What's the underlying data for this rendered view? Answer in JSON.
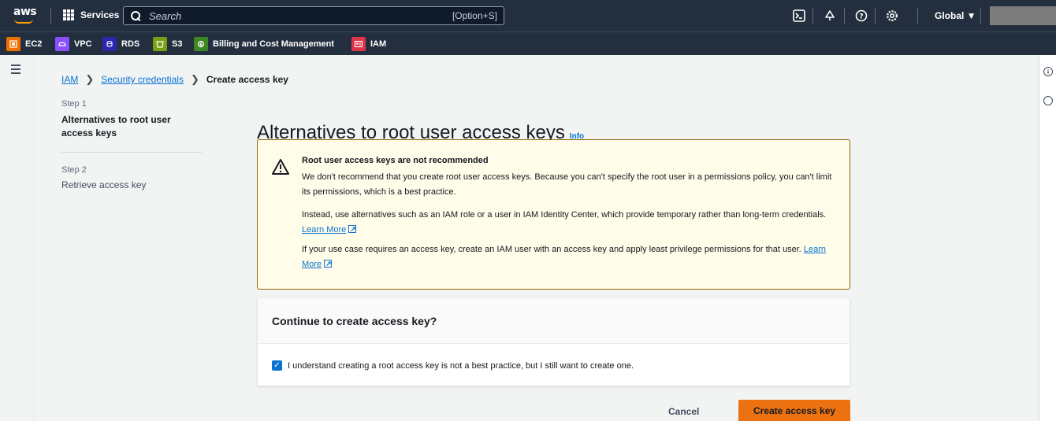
{
  "topbar": {
    "logo_text": "aws",
    "services_label": "Services",
    "search_placeholder": "Search",
    "search_shortcut": "[Option+S]",
    "region_label": "Global ▼"
  },
  "favorites": [
    {
      "label": "EC2",
      "color": "#ed7100"
    },
    {
      "label": "VPC",
      "color": "#8c4fff"
    },
    {
      "label": "RDS",
      "color": "#2e27ad"
    },
    {
      "label": "S3",
      "color": "#7aa116"
    },
    {
      "label": "Billing and Cost Management",
      "color": "#3f8624"
    },
    {
      "label": "IAM",
      "color": "#dd344c"
    }
  ],
  "breadcrumb": {
    "items": [
      "IAM",
      "Security credentials"
    ],
    "current": "Create access key"
  },
  "steps": [
    {
      "number": "Step 1",
      "title": "Alternatives to root user access keys"
    },
    {
      "number": "Step 2",
      "title": "Retrieve access key"
    }
  ],
  "main": {
    "title": "Alternatives to root user access keys",
    "info_label": "Info"
  },
  "alert": {
    "title": "Root user access keys are not recommended",
    "para1": "We don't recommend that you create root user access keys. Because you can't specify the root user in a permissions policy, you can't limit its permissions, which is a best practice.",
    "para2": "Instead, use alternatives such as an IAM role or a user in IAM Identity Center, which provide temporary rather than long-term credentials.",
    "para3": "If your use case requires an access key, create an IAM user with an access key and apply least privilege permissions for that user.",
    "learn_more": "Learn More"
  },
  "confirm": {
    "heading": "Continue to create access key?",
    "checkbox_label": "I understand creating a root access key is not a best practice, but I still want to create one.",
    "checked": true
  },
  "actions": {
    "cancel": "Cancel",
    "create": "Create access key"
  }
}
